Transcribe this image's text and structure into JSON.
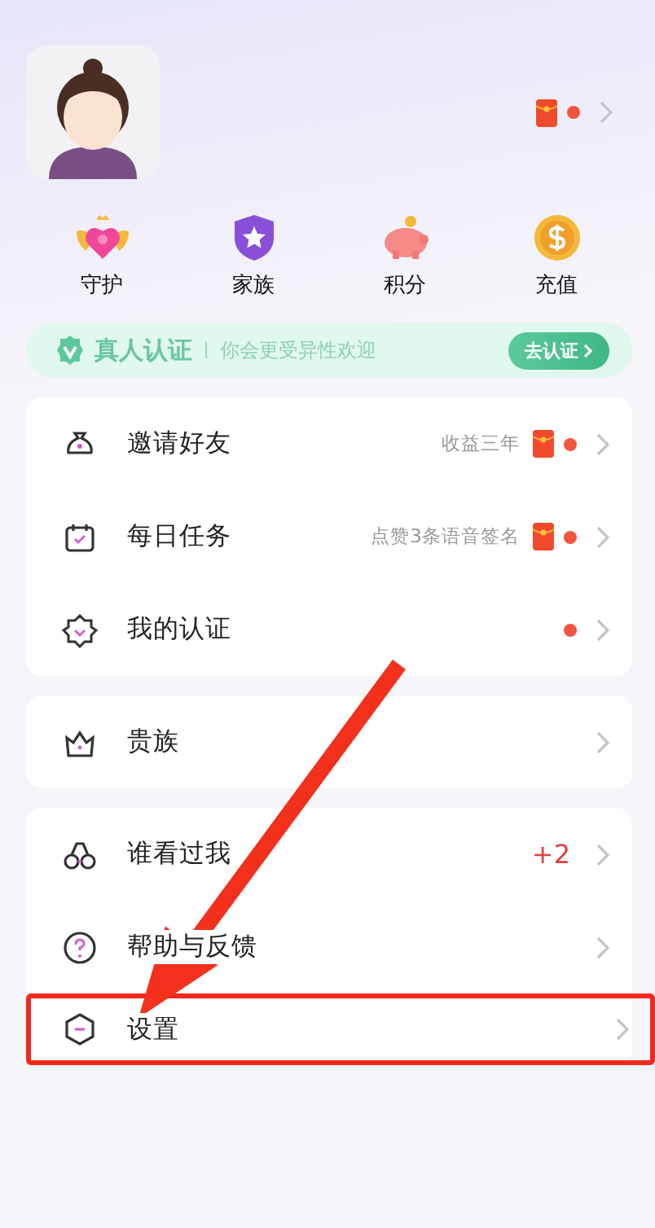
{
  "header": {
    "envelope": true,
    "dot": true
  },
  "quick_actions": [
    {
      "label": "守护",
      "kind": "guard"
    },
    {
      "label": "家族",
      "kind": "family"
    },
    {
      "label": "积分",
      "kind": "points"
    },
    {
      "label": "充值",
      "kind": "recharge"
    }
  ],
  "verify_banner": {
    "title": "真人认证",
    "subtitle": "你会更受异性欢迎",
    "button": "去认证"
  },
  "groups": [
    {
      "items": [
        {
          "label": "邀请好友",
          "hint": "收益三年",
          "envelope": true,
          "dot": true,
          "highlighted": false
        },
        {
          "label": "每日任务",
          "hint": "点赞3条语音签名",
          "envelope": true,
          "dot": true,
          "highlighted": false
        },
        {
          "label": "我的认证",
          "envelope": false,
          "dot": true,
          "highlighted": false
        }
      ]
    },
    {
      "items": [
        {
          "label": "贵族",
          "envelope": false,
          "dot": false,
          "highlighted": false
        }
      ]
    },
    {
      "items": [
        {
          "label": "谁看过我",
          "count": "+2",
          "envelope": false,
          "dot": false,
          "highlighted": false
        },
        {
          "label": "帮助与反馈",
          "envelope": false,
          "dot": false,
          "highlighted": false
        },
        {
          "label": "设置",
          "envelope": false,
          "dot": false,
          "highlighted": true
        }
      ]
    }
  ]
}
